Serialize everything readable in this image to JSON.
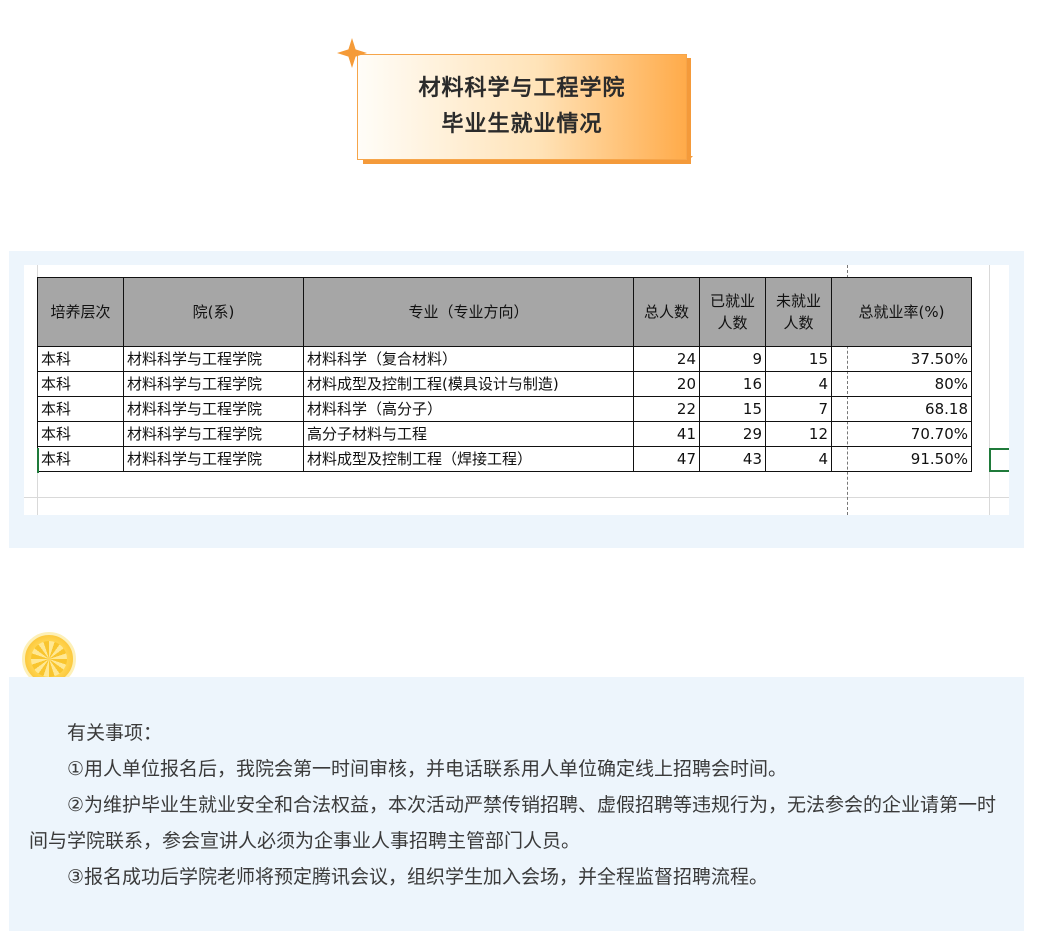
{
  "title": {
    "line1": "材料科学与工程学院",
    "line2": "毕业生就业情况"
  },
  "table": {
    "headers": [
      "培养层次",
      "院(系)",
      "专业（专业方向）",
      "总人数",
      "已就业人数",
      "未就业人数",
      "总就业率(%)"
    ],
    "rows": [
      [
        "本科",
        "材料科学与工程学院",
        "材料科学（复合材料）",
        "24",
        "9",
        "15",
        "37.50%"
      ],
      [
        "本科",
        "材料科学与工程学院",
        "材料成型及控制工程(模具设计与制造)",
        "20",
        "16",
        "4",
        "80%"
      ],
      [
        "本科",
        "材料科学与工程学院",
        "材料科学（高分子）",
        "22",
        "15",
        "7",
        "68.18"
      ],
      [
        "本科",
        "材料科学与工程学院",
        "高分子材料与工程",
        "41",
        "29",
        "12",
        "70.70%"
      ],
      [
        "本科",
        "材料科学与工程学院",
        "材料成型及控制工程（焊接工程）",
        "47",
        "43",
        "4",
        "91.50%"
      ]
    ]
  },
  "notes": {
    "heading": "有关事项：",
    "item1": "①用人单位报名后，我院会第一时间审核，并电话联系用人单位确定线上招聘会时间。",
    "item2": "②为维护毕业生就业安全和合法权益，本次活动严禁传销招聘、虚假招聘等违规行为，无法参会的企业请第一时间与学院联系，参会宣讲人必须为企事业人事招聘主管部门人员。",
    "item3": "③报名成功后学院老师将预定腾讯会议，组织学生加入会场，并全程监督招聘流程。"
  },
  "colors": {
    "accent": "#f59b38",
    "panel_bg": "#edf5fc",
    "header_bg": "#a6a6a6",
    "selection": "#1f7a3a"
  }
}
